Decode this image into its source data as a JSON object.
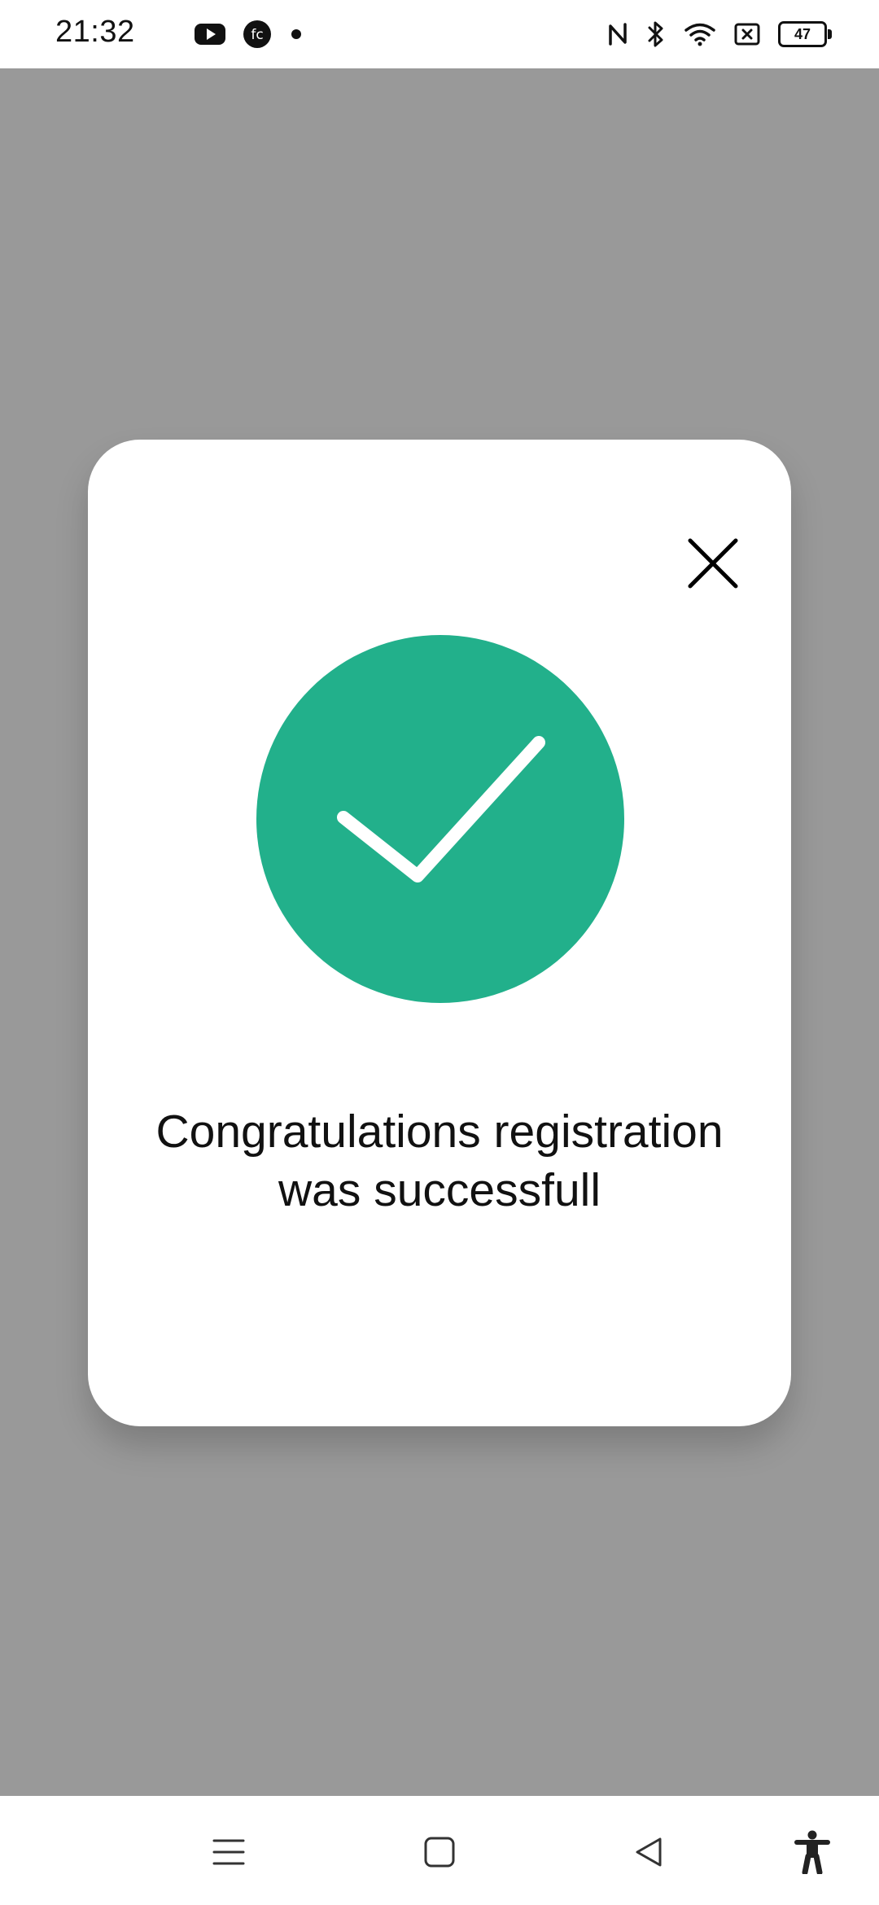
{
  "status_bar": {
    "time": "21:32",
    "left_icons": [
      "youtube-icon",
      "fc-app-icon",
      "notification-dot-icon"
    ],
    "right_icons": [
      "nfc-icon",
      "bluetooth-icon",
      "wifi-icon",
      "sim-icon",
      "battery-icon"
    ],
    "battery_level": "47"
  },
  "dialog": {
    "close_icon": "close-icon",
    "success_icon": "check-circle-icon",
    "success_color": "#22b08b",
    "message": "Congratulations registration was successfull"
  },
  "nav_bar": {
    "buttons": [
      "menu-icon",
      "home-icon",
      "back-icon",
      "accessibility-icon"
    ]
  },
  "colors": {
    "overlay": "#999999",
    "dialog_background": "#ffffff"
  }
}
